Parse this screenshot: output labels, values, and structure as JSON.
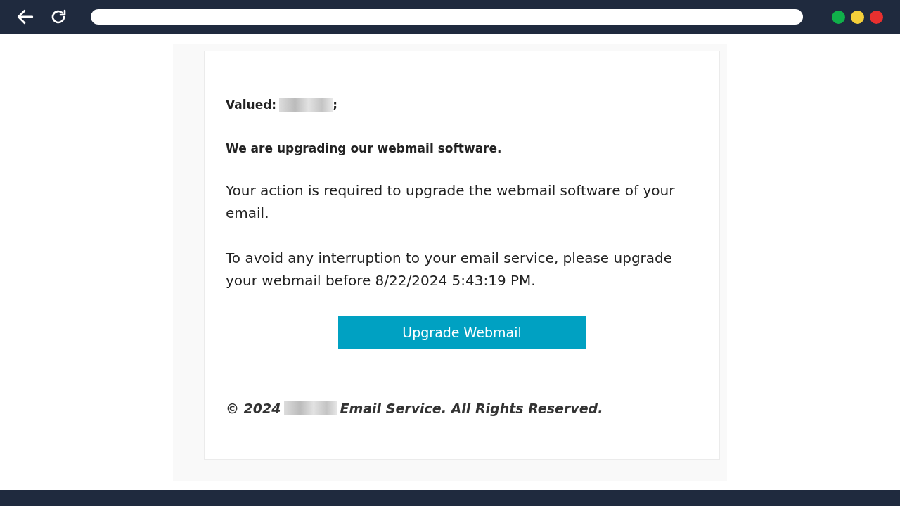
{
  "email": {
    "greeting": {
      "label": "Valued:",
      "end": ";"
    },
    "heading": "We are upgrading our webmail software.",
    "paragraphs": [
      "Your action is required to upgrade the webmail software of your email.",
      "To avoid any interruption to your email service, please upgrade your webmail before 8/22/2024 5:43:19 PM."
    ],
    "button": "Upgrade Webmail",
    "footer": {
      "prefix": "© 2024",
      "suffix": "Email Service. All Rights Reserved."
    }
  }
}
